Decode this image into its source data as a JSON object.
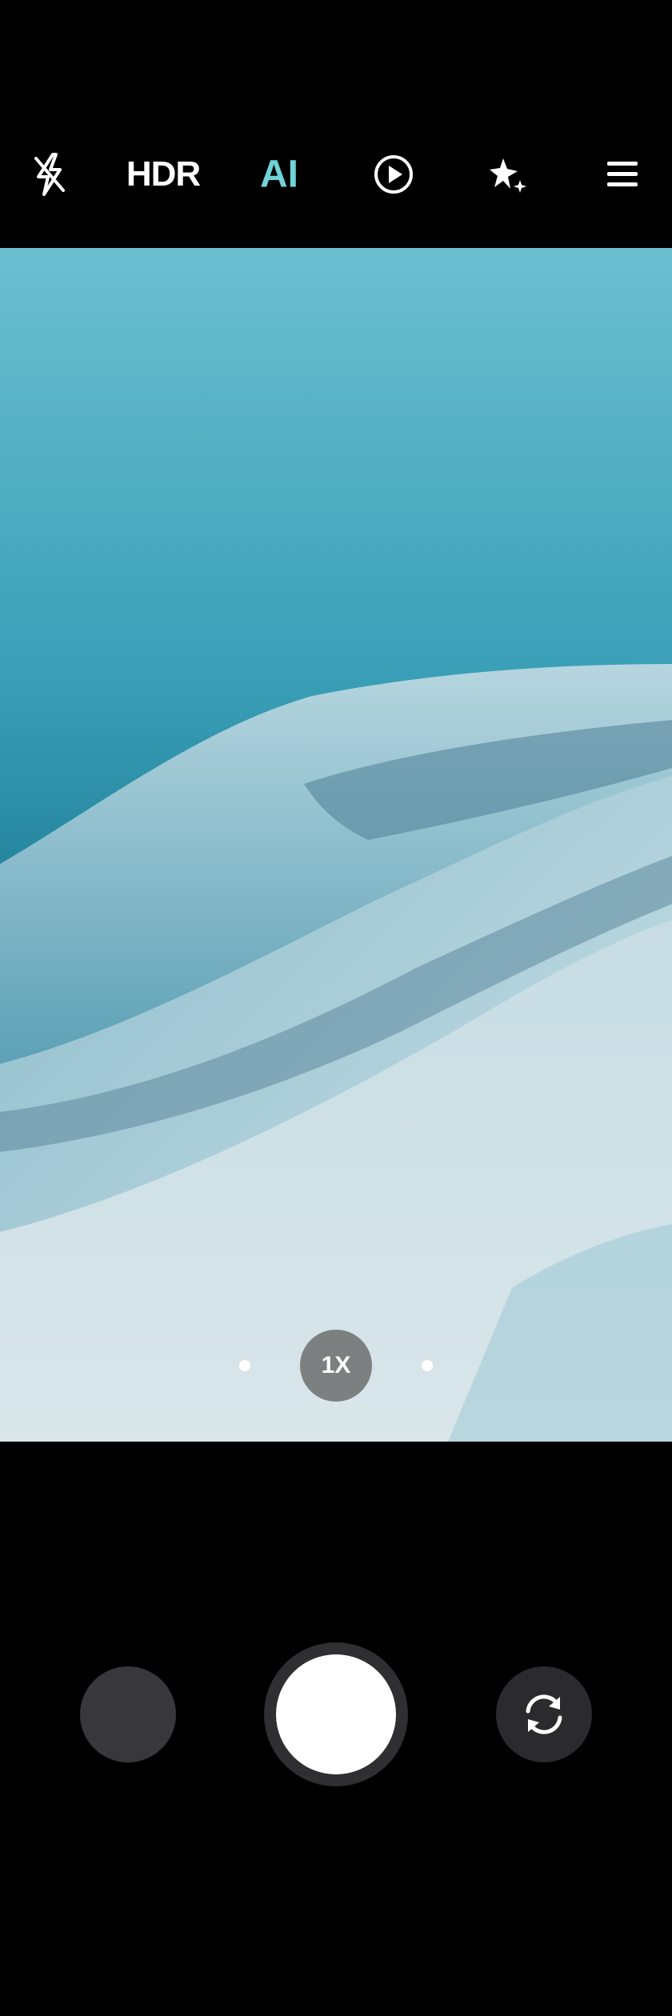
{
  "top_bar": {
    "flash_icon": "flash-off-icon",
    "hdr_label": "HDR",
    "ai_label": "AI",
    "live_icon": "play-circle-icon",
    "beauty_icon": "sparkle-icon",
    "menu_icon": "hamburger-menu-icon"
  },
  "viewfinder": {
    "zoom_label": "1X"
  },
  "bottom_controls": {
    "gallery_icon": "gallery-thumbnail",
    "shutter_icon": "shutter-icon",
    "switch_icon": "camera-switch-icon"
  },
  "colors": {
    "ai_accent": "#6fd3d8",
    "background": "#000000"
  }
}
